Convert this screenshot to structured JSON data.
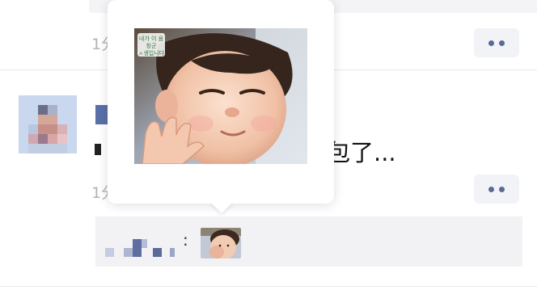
{
  "comments": [
    {
      "time": "1分",
      "more_icon": "more-dots-icon"
    },
    {
      "avatar": "avatar-mosaic",
      "text_start": "",
      "text_end": "包了...",
      "time": "1分",
      "more_icon": "more-dots-icon",
      "reply": {
        "colon": ":",
        "sticker": "baby-sticker-thumbnail"
      }
    }
  ],
  "popup": {
    "image": "baby-sticker-preview",
    "caption_line1": "내가 이 음칭군",
    "caption_line2": "ㅅ생입니다"
  },
  "colors": {
    "more_dots": "#5a6a93",
    "reply_bg": "#f2f2f5",
    "time_text": "#b3b3b3"
  }
}
